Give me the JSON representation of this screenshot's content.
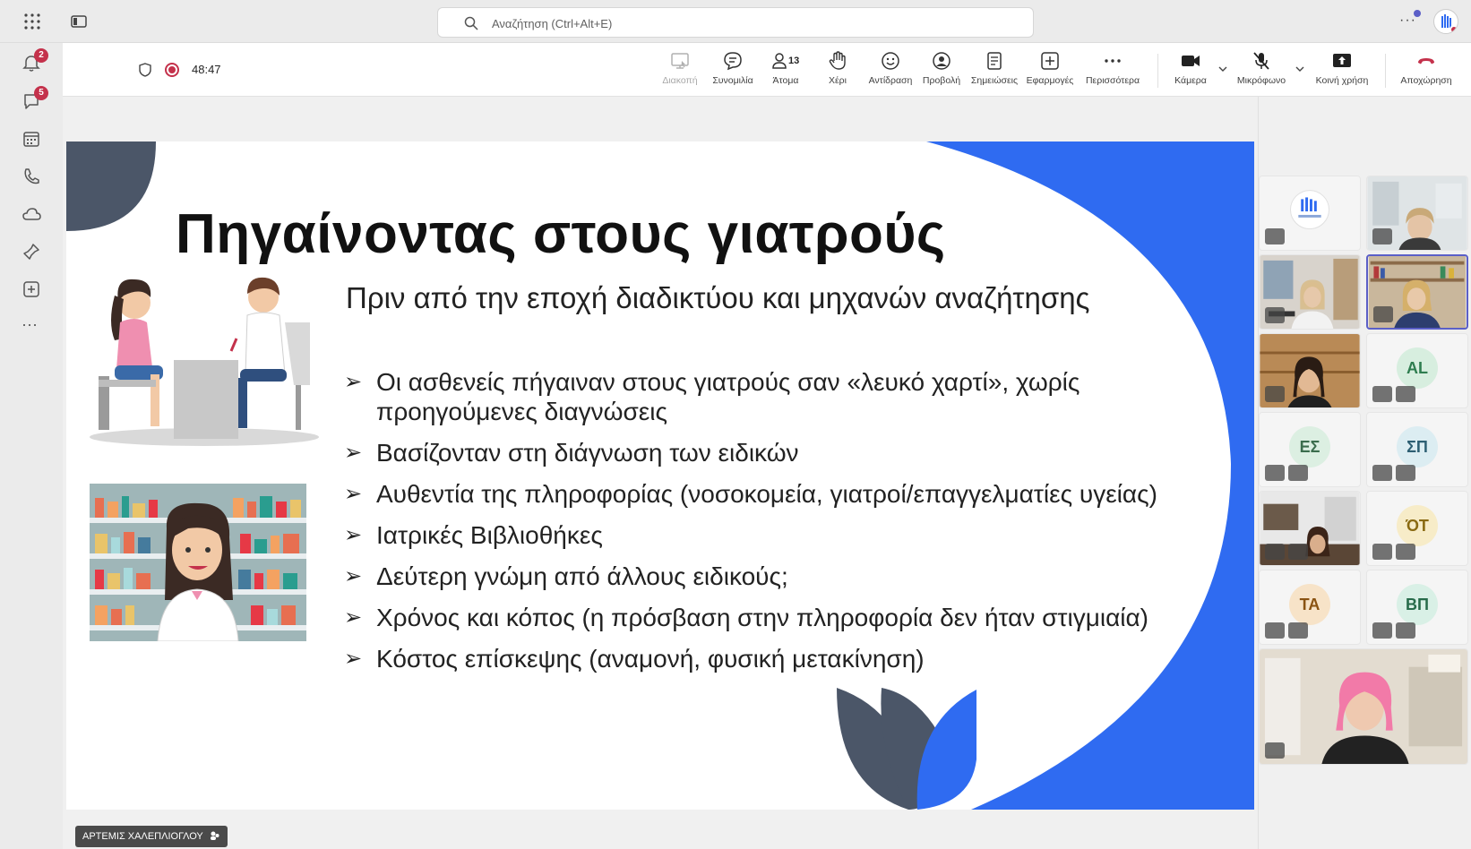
{
  "search": {
    "placeholder": "Αναζήτηση (Ctrl+Alt+E)"
  },
  "rail": {
    "badges": {
      "activity": "2",
      "chat": "5"
    }
  },
  "meeting": {
    "timer": "48:47",
    "tools": [
      {
        "id": "stop-presenting",
        "label": "Διακοπή",
        "disabled": true
      },
      {
        "id": "chat",
        "label": "Συνομιλία"
      },
      {
        "id": "people",
        "label": "Άτομα",
        "count": "13"
      },
      {
        "id": "raise-hand",
        "label": "Χέρι"
      },
      {
        "id": "react",
        "label": "Αντίδραση"
      },
      {
        "id": "view",
        "label": "Προβολή"
      },
      {
        "id": "notes",
        "label": "Σημειώσεις"
      },
      {
        "id": "apps",
        "label": "Εφαρμογές"
      },
      {
        "id": "more",
        "label": "Περισσότερα"
      },
      {
        "id": "camera",
        "label": "Κάμερα"
      },
      {
        "id": "mic",
        "label": "Μικρόφωνο"
      },
      {
        "id": "share",
        "label": "Κοινή χρήση"
      },
      {
        "id": "leave",
        "label": "Αποχώρηση"
      }
    ],
    "colors": {
      "leave": "#c4314b",
      "accent": "#5b5fc7"
    }
  },
  "slide": {
    "title": "Πηγαίνοντας στους γιατρούς",
    "subtitle": "Πριν από την εποχή διαδικτύου και μηχανών αναζήτησης",
    "bullets": [
      "Οι ασθενείς πήγαιναν στους γιατρούς σαν «λευκό χαρτί», χωρίς προηγούμενες διαγνώσεις",
      "Βασίζονταν στη διάγνωση των ειδικών",
      "Αυθεντία της πληροφορίας (νοσοκομεία, γιατροί/επαγγελματίες υγείας)",
      "Ιατρικές Βιβλιοθήκες",
      "Δεύτερη γνώμη από άλλους ειδικούς;",
      "Χρόνος και κόπος (η πρόσβαση στην πληροφορία δεν ήταν στιγμιαία)",
      "Κόστος επίσκεψης (αναμονή, φυσική μετακίνηση)"
    ],
    "colors": {
      "blue": "#2f6bf1",
      "slate": "#4b5668"
    }
  },
  "presenter": {
    "name": "ΑΡΤΕΜΙΣ ΧΑΛΕΠΛΙΟΓΛΟΥ"
  },
  "participants": [
    {
      "type": "logo"
    },
    {
      "type": "video"
    },
    {
      "type": "video"
    },
    {
      "type": "video",
      "active": true
    },
    {
      "type": "video"
    },
    {
      "type": "initials",
      "initials": "AL",
      "bg": "#d7eedf",
      "fg": "#2e7d4f"
    },
    {
      "type": "initials",
      "initials": "ΕΣ",
      "bg": "#dcefe2",
      "fg": "#3b6d4d"
    },
    {
      "type": "initials",
      "initials": "ΣΠ",
      "bg": "#dcedf2",
      "fg": "#2d5f73"
    },
    {
      "type": "video"
    },
    {
      "type": "initials",
      "initials": "ΌΤ",
      "bg": "#f7ecc8",
      "fg": "#8a6a12"
    },
    {
      "type": "initials",
      "initials": "ΤΑ",
      "bg": "#f7e3c8",
      "fg": "#8a5312"
    },
    {
      "type": "initials",
      "initials": "ΒΠ",
      "bg": "#d9f0e6",
      "fg": "#276b4a"
    },
    {
      "type": "video-large"
    }
  ]
}
